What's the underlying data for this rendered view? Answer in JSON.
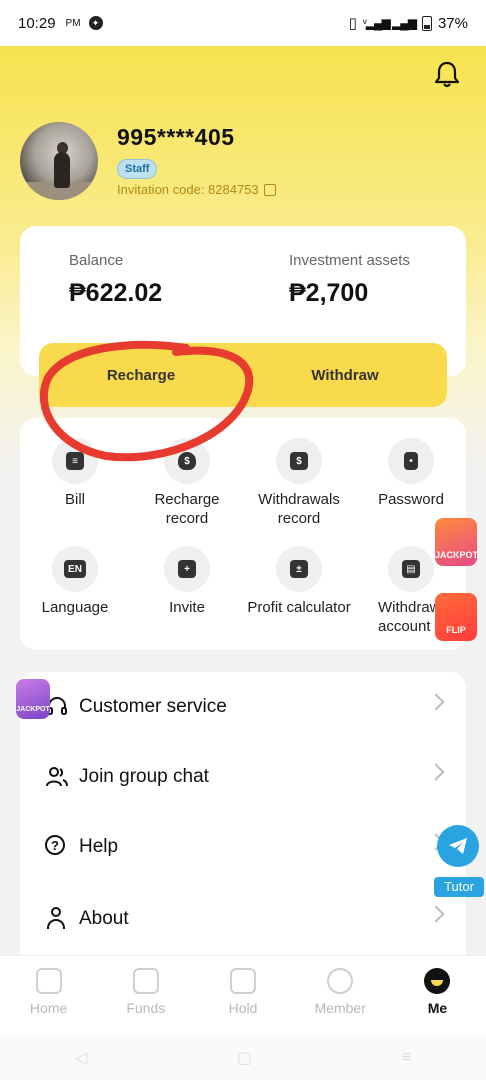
{
  "status_bar": {
    "time": "10:29",
    "ampm": "PM",
    "battery": "37%"
  },
  "profile": {
    "phone": "995****405",
    "badge": "Staff",
    "invitation_code": "Invitation code: 8284753"
  },
  "balance": {
    "balance_label": "Balance",
    "balance_value": "₱622.02",
    "assets_label": "Investment assets",
    "assets_value": "₱2,700",
    "recharge_label": "Recharge",
    "withdraw_label": "Withdraw"
  },
  "grid": [
    {
      "label": "Bill",
      "icon": "bill-icon"
    },
    {
      "label": "Recharge record",
      "icon": "money-bag-icon"
    },
    {
      "label": "Withdrawals record",
      "icon": "cash-box-icon"
    },
    {
      "label": "Password",
      "icon": "lock-icon"
    },
    {
      "label": "Language",
      "icon": "language-icon",
      "glyph": "EN"
    },
    {
      "label": "Invite",
      "icon": "gift-icon"
    },
    {
      "label": "Profit calculator",
      "icon": "calculator-icon"
    },
    {
      "label": "Withdrawal account",
      "icon": "account-card-icon"
    }
  ],
  "list": [
    {
      "label": "Customer service",
      "icon": "headset-icon"
    },
    {
      "label": "Join group chat",
      "icon": "group-icon"
    },
    {
      "label": "Help",
      "icon": "help-icon"
    },
    {
      "label": "About",
      "icon": "user-icon"
    }
  ],
  "promos": {
    "jackpot": "JACKPOT",
    "flip": "FLIP"
  },
  "tutor_label": "Tutor",
  "nav": [
    {
      "label": "Home",
      "icon": "home-icon"
    },
    {
      "label": "Funds",
      "icon": "funds-icon"
    },
    {
      "label": "Hold",
      "icon": "briefcase-icon"
    },
    {
      "label": "Member",
      "icon": "member-icon"
    },
    {
      "label": "Me",
      "icon": "me-icon",
      "active": true
    }
  ],
  "colors": {
    "accent": "#f9da4c",
    "annotation": "#e63b2e",
    "telegram": "#2aa4e0"
  }
}
